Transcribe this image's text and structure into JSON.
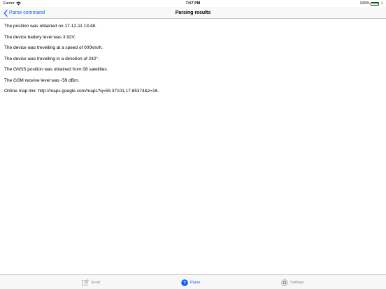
{
  "status_bar": {
    "carrier": "Carrier",
    "time": "7:57 PM",
    "battery": "100%"
  },
  "nav_bar": {
    "back_label": "Parse command",
    "title": "Parsing results"
  },
  "results": [
    "The position was obtained on 17-12-11 13:48.",
    "The device battery level was 3.92V.",
    "The device was trevelling at a speed of 000km/h.",
    "The device was trevelling in a direction of 242°.",
    "The GNSS position was obtained from 08 satellites.",
    "The GSM receive level was -59 dBm.",
    "Online map link: http://maps.google.com/maps?q=59.37101,17.85374&z=16."
  ],
  "tab_bar": {
    "send": "Send",
    "parse": "Parse",
    "settings": "Settings",
    "active": "parse"
  },
  "colors": {
    "accent": "#0a60ff",
    "inactive": "#8e8e93",
    "battery": "#4cd964"
  }
}
